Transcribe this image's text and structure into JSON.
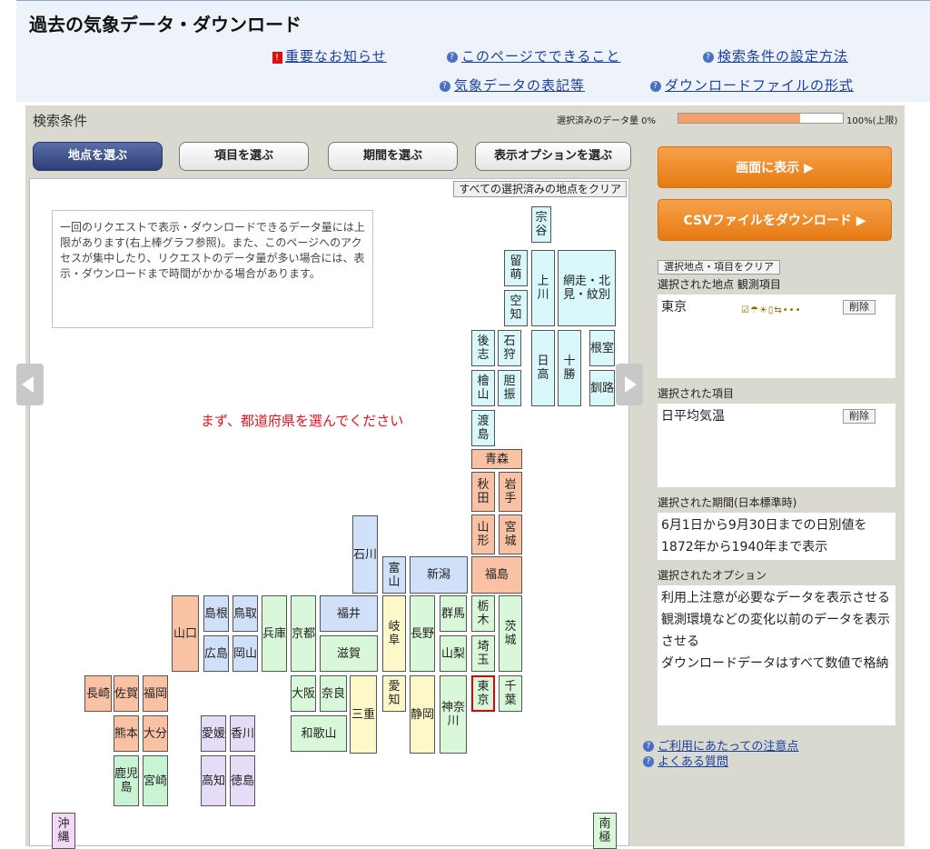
{
  "header": {
    "title": "過去の気象データ・ダウンロード",
    "links": {
      "notice": "重要なお知らせ",
      "can_do": "このページでできること",
      "how_to_set": "検索条件の設定方法",
      "notation": "気象データの表記等",
      "file_format": "ダウンロードファイルの形式"
    }
  },
  "panel": {
    "title": "検索条件",
    "quota_label": "選択済みのデータ量 0%",
    "quota_max": "100%(上限)",
    "quota_fraction": 0.74
  },
  "tabs": {
    "station": "地点を選ぶ",
    "item": "項目を選ぶ",
    "period": "期間を選ぶ",
    "option": "表示オプションを選ぶ"
  },
  "map": {
    "clear_all": "すべての選択済みの地点をクリア",
    "notice": "一回のリクエストで表示・ダウンロードできるデータ量には上限があります(右上棒グラフ参照)。また、このページへのアクセスが集中したり、リクエストのデータ量が多い場合には、表示・ダウンロードまで時間がかかる場合があります。",
    "prompt": "まず、都道府県を選んでください",
    "prefs": {
      "soya": "宗谷",
      "rumoi": "留萌",
      "kamikawa": "上川",
      "abashiri": "網走・北見・紋別",
      "sorachi": "空知",
      "shiribeshi": "後志",
      "ishikari": "石狩",
      "hidaka": "日高",
      "tokachi": "十勝",
      "nemuro": "根室",
      "hiyama": "檜山",
      "iburi": "胆振",
      "kushiro": "釧路",
      "oshima": "渡島",
      "aomori": "青森",
      "akita": "秋田",
      "iwate": "岩手",
      "yamagata": "山形",
      "miyagi": "宮城",
      "ishikawa": "石川",
      "toyama": "富山",
      "niigata": "新潟",
      "fukushima": "福島",
      "yamaguchi": "山口",
      "shimane": "島根",
      "tottori": "鳥取",
      "hyogo": "兵庫",
      "kyoto": "京都",
      "fukui": "福井",
      "gifu": "岐阜",
      "nagano": "長野",
      "gunma": "群馬",
      "tochigi": "栃木",
      "ibaraki": "茨城",
      "hiroshima": "広島",
      "okayama": "岡山",
      "shiga": "滋賀",
      "yamanashi": "山梨",
      "saitama": "埼玉",
      "nagasaki": "長崎",
      "saga": "佐賀",
      "fukuoka": "福岡",
      "osaka": "大阪",
      "nara": "奈良",
      "mie": "三重",
      "aichi": "愛知",
      "shizuoka": "静岡",
      "kanagawa": "神奈川",
      "tokyo": "東京",
      "chiba": "千葉",
      "kumamoto": "熊本",
      "oita": "大分",
      "ehime": "愛媛",
      "kagawa": "香川",
      "wakayama": "和歌山",
      "kagoshima": "鹿児島",
      "miyazaki": "宮崎",
      "kochi": "高知",
      "tokushima": "徳島",
      "okinawa": "沖縄",
      "antarctica": "南極"
    }
  },
  "side": {
    "show_button": "画面に表示 ▶",
    "csv_button": "CSVファイルをダウンロード ▶",
    "clear_button": "選択地点・項目をクリア",
    "station_label": "選択された地点 観測項目",
    "station_value": "東京",
    "delete_label": "削除",
    "item_label": "選択された項目",
    "item_value": "日平均気温",
    "period_label": "選択された期間(日本標準時)",
    "period_line1": "6月1日から9月30日までの日別値を",
    "period_line2": "1872年から1940年まで表示",
    "option_label": "選択されたオプション",
    "option_line1": "利用上注意が必要なデータを表示させる",
    "option_line2": "観測環境などの変化以前のデータを表示させる",
    "option_line3": "ダウンロードデータはすべて数値で格納"
  },
  "footer": {
    "notes_link": "ご利用にあたっての注意点",
    "faq_link": "よくある質問"
  },
  "colors": {
    "accent_orange": "#e67a13",
    "active_tab": "#2e3f78",
    "selected_border": "#dd0000"
  }
}
